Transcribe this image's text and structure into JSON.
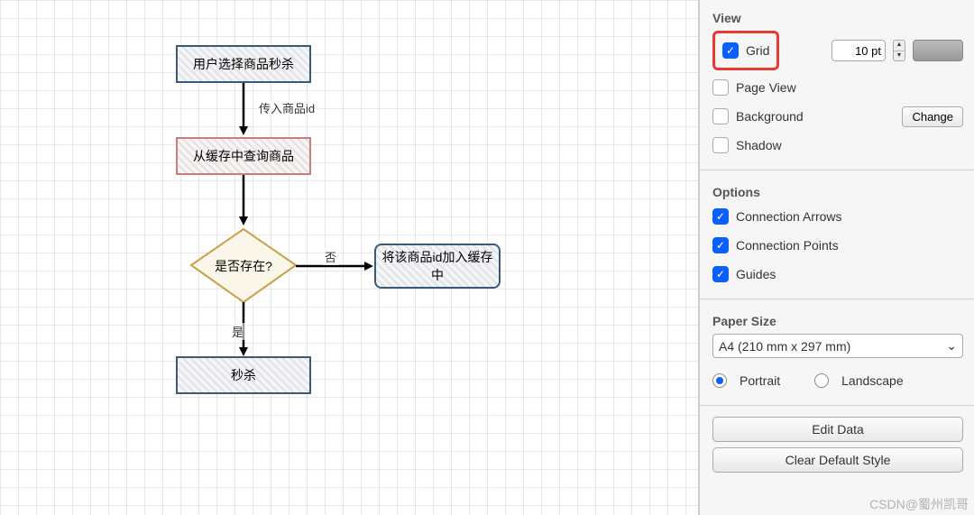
{
  "flow": {
    "node1": "用户选择商品秒杀",
    "edge12_label": "传入商品id",
    "node2": "从缓存中查询商品",
    "diamond": "是否存在?",
    "edge_no": "否",
    "edge_yes": "是",
    "node3": "将该商品id加入缓存中",
    "node4": "秒杀"
  },
  "sidebar": {
    "view": {
      "title": "View",
      "grid_label": "Grid",
      "grid_value": "10 pt",
      "pageview_label": "Page View",
      "background_label": "Background",
      "change_btn": "Change",
      "shadow_label": "Shadow"
    },
    "options": {
      "title": "Options",
      "conn_arrows": "Connection Arrows",
      "conn_points": "Connection Points",
      "guides": "Guides"
    },
    "paper": {
      "title": "Paper Size",
      "size": "A4 (210 mm x 297 mm)",
      "portrait": "Portrait",
      "landscape": "Landscape"
    },
    "buttons": {
      "edit_data": "Edit Data",
      "clear_style": "Clear Default Style"
    }
  },
  "watermark": "CSDN@蜀州凯哥"
}
